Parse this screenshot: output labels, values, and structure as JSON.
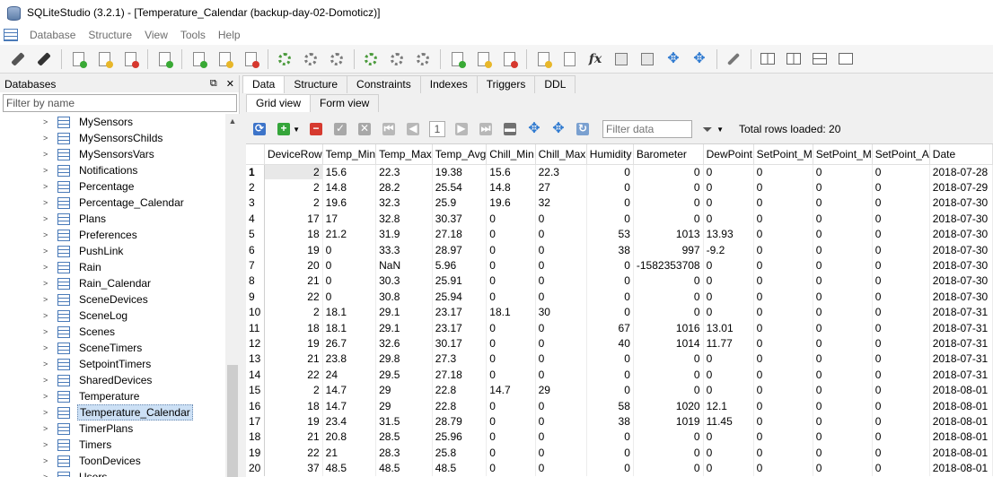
{
  "window": {
    "title": "SQLiteStudio (3.2.1) - [Temperature_Calendar (backup-day-02-Domoticz)]"
  },
  "menu": [
    "Database",
    "Structure",
    "View",
    "Tools",
    "Help"
  ],
  "db_panel": {
    "title": "Databases",
    "filter_placeholder": "Filter by name",
    "items": [
      "MySensors",
      "MySensorsChilds",
      "MySensorsVars",
      "Notifications",
      "Percentage",
      "Percentage_Calendar",
      "Plans",
      "Preferences",
      "PushLink",
      "Rain",
      "Rain_Calendar",
      "SceneDevices",
      "SceneLog",
      "Scenes",
      "SceneTimers",
      "SetpointTimers",
      "SharedDevices",
      "Temperature",
      "Temperature_Calendar",
      "TimerPlans",
      "Timers",
      "ToonDevices",
      "Users"
    ],
    "selected": "Temperature_Calendar"
  },
  "tabs": [
    "Data",
    "Structure",
    "Constraints",
    "Indexes",
    "Triggers",
    "DDL"
  ],
  "active_tab": "Data",
  "subtabs": [
    "Grid view",
    "Form view"
  ],
  "active_subtab": "Grid view",
  "grid_toolbar": {
    "page": "1",
    "filter_placeholder": "Filter data",
    "total_rows": "Total rows loaded: 20"
  },
  "grid": {
    "columns": [
      "DeviceRow",
      "Temp_Min",
      "Temp_Max",
      "Temp_Avg",
      "Chill_Min",
      "Chill_Max",
      "Humidity",
      "Barometer",
      "DewPoint",
      "SetPoint_M",
      "SetPoint_M",
      "SetPoint_A",
      "Date"
    ],
    "rows": [
      [
        "2",
        "15.6",
        "22.3",
        "19.38",
        "15.6",
        "22.3",
        "0",
        "0",
        "0",
        "0",
        "0",
        "0",
        "2018-07-28"
      ],
      [
        "2",
        "14.8",
        "28.2",
        "25.54",
        "14.8",
        "27",
        "0",
        "0",
        "0",
        "0",
        "0",
        "0",
        "2018-07-29"
      ],
      [
        "2",
        "19.6",
        "32.3",
        "25.9",
        "19.6",
        "32",
        "0",
        "0",
        "0",
        "0",
        "0",
        "0",
        "2018-07-30"
      ],
      [
        "17",
        "17",
        "32.8",
        "30.37",
        "0",
        "0",
        "0",
        "0",
        "0",
        "0",
        "0",
        "0",
        "2018-07-30"
      ],
      [
        "18",
        "21.2",
        "31.9",
        "27.18",
        "0",
        "0",
        "53",
        "1013",
        "13.93",
        "0",
        "0",
        "0",
        "2018-07-30"
      ],
      [
        "19",
        "0",
        "33.3",
        "28.97",
        "0",
        "0",
        "38",
        "997",
        "-9.2",
        "0",
        "0",
        "0",
        "2018-07-30"
      ],
      [
        "20",
        "0",
        "NaN",
        "5.96",
        "0",
        "0",
        "0",
        "-1582353708",
        "0",
        "0",
        "0",
        "0",
        "2018-07-30"
      ],
      [
        "21",
        "0",
        "30.3",
        "25.91",
        "0",
        "0",
        "0",
        "0",
        "0",
        "0",
        "0",
        "0",
        "2018-07-30"
      ],
      [
        "22",
        "0",
        "30.8",
        "25.94",
        "0",
        "0",
        "0",
        "0",
        "0",
        "0",
        "0",
        "0",
        "2018-07-30"
      ],
      [
        "2",
        "18.1",
        "29.1",
        "23.17",
        "18.1",
        "30",
        "0",
        "0",
        "0",
        "0",
        "0",
        "0",
        "2018-07-31"
      ],
      [
        "18",
        "18.1",
        "29.1",
        "23.17",
        "0",
        "0",
        "67",
        "1016",
        "13.01",
        "0",
        "0",
        "0",
        "2018-07-31"
      ],
      [
        "19",
        "26.7",
        "32.6",
        "30.17",
        "0",
        "0",
        "40",
        "1014",
        "11.77",
        "0",
        "0",
        "0",
        "2018-07-31"
      ],
      [
        "21",
        "23.8",
        "29.8",
        "27.3",
        "0",
        "0",
        "0",
        "0",
        "0",
        "0",
        "0",
        "0",
        "2018-07-31"
      ],
      [
        "22",
        "24",
        "29.5",
        "27.18",
        "0",
        "0",
        "0",
        "0",
        "0",
        "0",
        "0",
        "0",
        "2018-07-31"
      ],
      [
        "2",
        "14.7",
        "29",
        "22.8",
        "14.7",
        "29",
        "0",
        "0",
        "0",
        "0",
        "0",
        "0",
        "2018-08-01"
      ],
      [
        "18",
        "14.7",
        "29",
        "22.8",
        "0",
        "0",
        "58",
        "1020",
        "12.1",
        "0",
        "0",
        "0",
        "2018-08-01"
      ],
      [
        "19",
        "23.4",
        "31.5",
        "28.79",
        "0",
        "0",
        "38",
        "1019",
        "11.45",
        "0",
        "0",
        "0",
        "2018-08-01"
      ],
      [
        "21",
        "20.8",
        "28.5",
        "25.96",
        "0",
        "0",
        "0",
        "0",
        "0",
        "0",
        "0",
        "0",
        "2018-08-01"
      ],
      [
        "22",
        "21",
        "28.3",
        "25.8",
        "0",
        "0",
        "0",
        "0",
        "0",
        "0",
        "0",
        "0",
        "2018-08-01"
      ],
      [
        "37",
        "48.5",
        "48.5",
        "48.5",
        "0",
        "0",
        "0",
        "0",
        "0",
        "0",
        "0",
        "0",
        "2018-08-01"
      ]
    ]
  }
}
